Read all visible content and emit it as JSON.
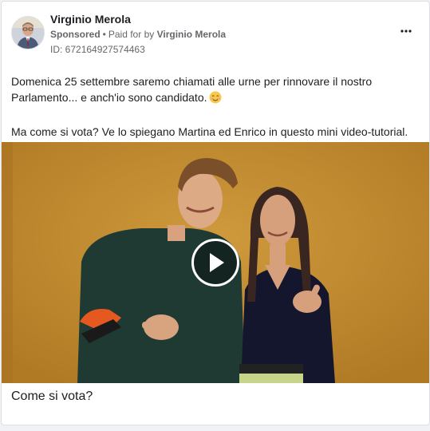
{
  "post": {
    "page_name": "Virginio Merola",
    "sponsored_label": "Sponsored",
    "separator": "•",
    "paid_for_label": "Paid for by",
    "payer": "Virginio Merola",
    "ad_id": "ID: 672164927574463",
    "more_icon": "more-horizontal-icon",
    "text_line_1": "Domenica 25 settembre saremo chiamati alle urne per rinnovare il nostro Parlamento... e anch'io sono candidato.",
    "emoji": "smiling-blushing-face-emoji",
    "text_line_2": "Ma come si vota? Ve lo spiegano Martina ed Enrico in questo mini video-tutorial.",
    "video_caption": "Come si vota?",
    "play_icon": "play-icon"
  },
  "colors": {
    "video_background": "#c0892d",
    "text_primary": "#1c1e21",
    "text_secondary": "#65676b"
  }
}
